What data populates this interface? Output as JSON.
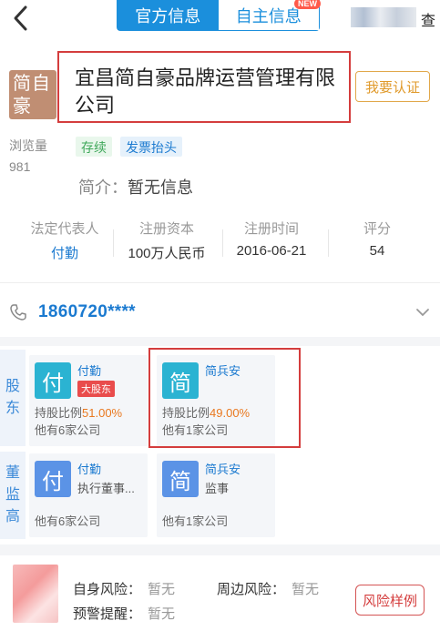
{
  "tabs": [
    {
      "label": "官方信息",
      "active": true
    },
    {
      "label": "自主信息",
      "active": false,
      "badge": "NEW"
    }
  ],
  "top_right_char": "查",
  "company": {
    "avatar_text": "简自豪",
    "name": "宜昌简自豪品牌运营管理有限公司",
    "certify_button": "我要认证",
    "views_label": "浏览量",
    "views_value": "981",
    "tags": [
      "存续",
      "发票抬头"
    ],
    "intro_label": "简介：",
    "intro_value": "暂无信息"
  },
  "stats": [
    {
      "label": "法定代表人",
      "value": "付勤"
    },
    {
      "label": "注册资本",
      "value": "100万人民币"
    },
    {
      "label": "注册时间",
      "value": "2016-06-21"
    },
    {
      "label": "评分",
      "value": "54"
    }
  ],
  "phone": "1860720****",
  "shareholders": {
    "label": [
      "股",
      "东"
    ],
    "cards": [
      {
        "icon_char": "付",
        "name": "付勤",
        "badge": "大股东",
        "share_label": "持股比例",
        "share_pct": "51.00%",
        "other": "他有6家公司"
      },
      {
        "icon_char": "简",
        "name": "简兵安",
        "share_label": "持股比例",
        "share_pct": "49.00%",
        "other": "他有1家公司"
      }
    ]
  },
  "executives": {
    "label": [
      "董",
      "监",
      "高"
    ],
    "cards": [
      {
        "icon_char": "付",
        "name": "付勤",
        "role": "执行董事...",
        "other": "他有6家公司"
      },
      {
        "icon_char": "简",
        "name": "简兵安",
        "role": "监事",
        "other": "他有1家公司"
      }
    ]
  },
  "risk": {
    "self_risk_label": "自身风险：",
    "self_risk_value": "暂无",
    "peripheral_label": "周边风险：",
    "peripheral_value": "暂无",
    "warning_label": "预警提醒：",
    "warning_value": "暂无",
    "sample_button": "风险样例"
  },
  "colors": {
    "accent_blue": "#1b8fdc",
    "highlight_red": "#d43d3d",
    "percent_orange": "#e9781f"
  }
}
